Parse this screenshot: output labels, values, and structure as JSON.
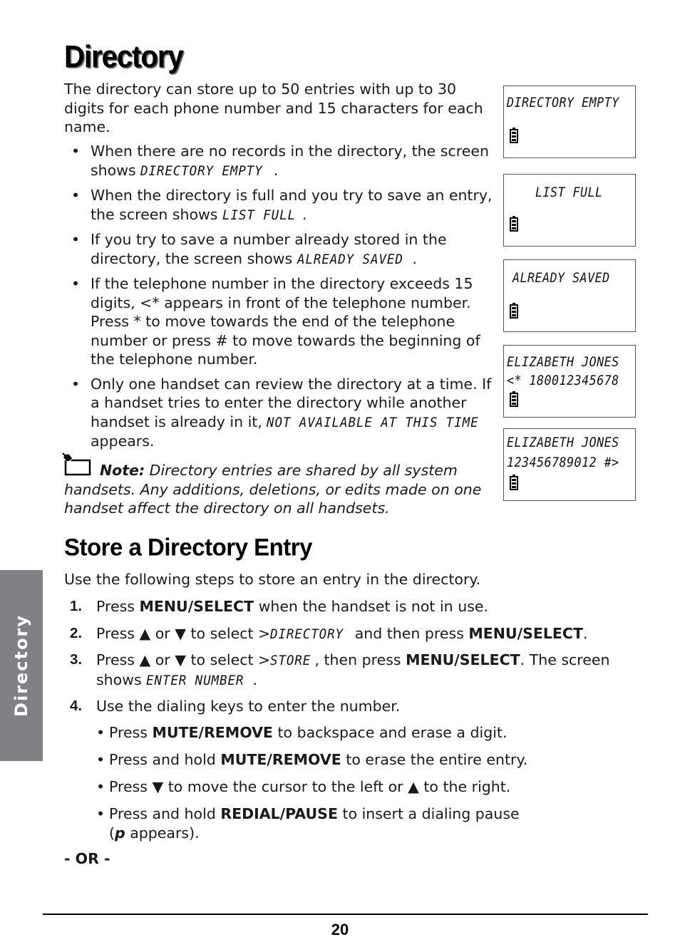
{
  "page": {
    "title": "Directory",
    "intro": "The directory can store up to 50 entries with up to 30 digits for each phone number and 15 characters for each name.",
    "bullets": [
      {
        "before": "When there are no records in the directory, the screen shows ",
        "lcd": "DIRECTORY EMPTY",
        "after": "."
      },
      {
        "before": "When the directory is full and you try to save an entry, the screen shows ",
        "lcd": "LIST FULL",
        "after": "."
      },
      {
        "before": "If you try to save a number already stored in the directory, the screen shows ",
        "lcd": "ALREADY SAVED",
        "after": "."
      },
      {
        "before": "If the telephone number in the directory exceeds 15 digits, <* appears in front of the telephone number. Press * to move towards the end of the telephone number or press # to move towards the beginning of the telephone number.",
        "lcd": "",
        "after": ""
      },
      {
        "before": "Only one handset can review the directory at a time. If a handset tries to enter the directory while another handset is already in it, ",
        "lcd": "NOT AVAILABLE AT THIS TIME",
        "after": " appears."
      }
    ],
    "bullet_char": "•",
    "note": {
      "label": "Note:",
      "text": " Directory entries are shared by all system handsets. Any additions, deletions, or edits made on one handset affect the directory on all handsets."
    },
    "screens": [
      {
        "line1": "DIRECTORY EMPTY",
        "line2": ""
      },
      {
        "line1": "LIST FULL",
        "line2": ""
      },
      {
        "line1": "ALREADY SAVED",
        "line2": ""
      },
      {
        "line1": "ELIZABETH JONES",
        "line2": "<* 180012345678"
      },
      {
        "line1": "ELIZABETH JONES",
        "line2": "123456789012 #>"
      }
    ],
    "section_title": "Store a Directory Entry",
    "steps_intro": "Use the following steps to store an entry in the directory.",
    "steps": [
      {
        "num": "1.",
        "parts": [
          "Press ",
          "MENU/SELECT",
          " when the handset is not in use."
        ]
      },
      {
        "num": "2.",
        "parts": [
          "Press ▲ or ▼ to select >",
          "DIRECTORY",
          " and then press ",
          "MENU/SELECT",
          "."
        ]
      },
      {
        "num": "3.",
        "parts": [
          "Press ▲ or ▼ to select >",
          "STORE",
          ", then press ",
          "MENU/SELECT",
          ". The screen shows ",
          "ENTER NUMBER",
          "."
        ]
      },
      {
        "num": "4.",
        "parts": [
          "Use the dialing keys to enter the number."
        ]
      }
    ],
    "sub_bullets": [
      {
        "a": "Press ",
        "b": "MUTE/REMOVE",
        "c": " to backspace and erase a digit."
      },
      {
        "a": "Press and hold ",
        "b": "MUTE/REMOVE",
        "c": " to erase the entire entry."
      },
      {
        "a": "Press ▼ to move the cursor to the left or ▲ to the right.",
        "b": "",
        "c": ""
      },
      {
        "a": "Press and hold ",
        "b": "REDIAL/PAUSE",
        "c": " to insert a dialing pause",
        "d": "(",
        "e": "p",
        "f": " appears)."
      }
    ],
    "or_label": "- OR -",
    "side_tab": "Directory",
    "page_number": "20"
  }
}
